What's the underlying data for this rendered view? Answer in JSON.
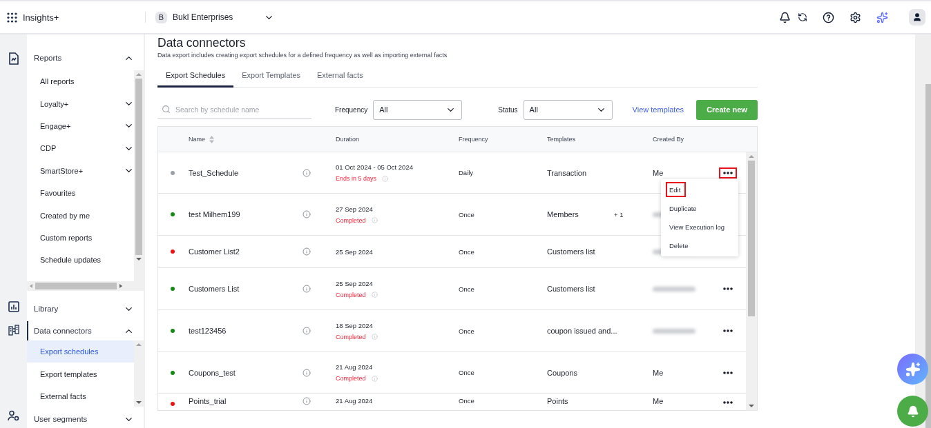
{
  "app": {
    "name": "Insights+"
  },
  "org": {
    "initial": "B",
    "name": "Bukl Enterprises"
  },
  "sidebar": {
    "sections": [
      {
        "label": "Reports",
        "expanded": true,
        "selected": false,
        "items": [
          {
            "label": "All reports",
            "has_children": false,
            "selected": false
          },
          {
            "label": "Loyalty+",
            "has_children": true,
            "expanded": false,
            "selected": false
          },
          {
            "label": "Engage+",
            "has_children": true,
            "expanded": false,
            "selected": false
          },
          {
            "label": "CDP",
            "has_children": true,
            "expanded": false,
            "selected": false
          },
          {
            "label": "SmartStore+",
            "has_children": true,
            "expanded": false,
            "selected": false
          },
          {
            "label": "Favourites",
            "has_children": false,
            "selected": false
          },
          {
            "label": "Created by me",
            "has_children": false,
            "selected": false
          },
          {
            "label": "Custom reports",
            "has_children": false,
            "selected": false
          },
          {
            "label": "Schedule updates",
            "has_children": false,
            "selected": false
          }
        ]
      },
      {
        "label": "Library",
        "expanded": false,
        "selected": false
      },
      {
        "label": "Data connectors",
        "expanded": true,
        "selected": true,
        "items": [
          {
            "label": "Export schedules",
            "has_children": false,
            "selected": true
          },
          {
            "label": "Export templates",
            "has_children": false,
            "selected": false
          },
          {
            "label": "External facts",
            "has_children": false,
            "selected": false
          }
        ]
      },
      {
        "label": "User segments",
        "expanded": false,
        "selected": false
      }
    ]
  },
  "page": {
    "title": "Data connectors",
    "subtitle": "Data export includes creating export schedules for a defined frequency as well as importing external facts"
  },
  "tabs": [
    {
      "label": "Export Schedules",
      "selected": true
    },
    {
      "label": "Export Templates",
      "selected": false
    },
    {
      "label": "External facts",
      "selected": false
    }
  ],
  "filters": {
    "search": {
      "placeholder": "Search by schedule name"
    },
    "frequency": {
      "label": "Frequency",
      "value": "All"
    },
    "status": {
      "label": "Status",
      "value": "All"
    },
    "link": "View templates",
    "create": "Create new"
  },
  "table": {
    "columns": [
      "Name",
      "Duration",
      "Frequency",
      "Templates",
      "Created By"
    ],
    "rows": [
      {
        "color": "#9aa0a8",
        "name": "Test_Schedule",
        "duration": "01 Oct 2024 - 05 Oct 2024",
        "status": "Ends in 5 days",
        "frequency": "Daily",
        "template": "Transaction",
        "extra": "",
        "created_by": "Me",
        "created_by_blurred": false,
        "menu_highlighted": true
      },
      {
        "color": "#138a13",
        "name": "test Milhem199",
        "duration": "27 Sep 2024",
        "status": "Completed",
        "frequency": "Once",
        "template": "Members",
        "extra": "+ 1",
        "created_by": "",
        "created_by_blurred": true
      },
      {
        "color": "#ee1111",
        "name": "Customer List2",
        "duration": "25 Sep 2024",
        "status": "",
        "frequency": "Once",
        "template": "Customers list",
        "extra": "",
        "created_by": "",
        "created_by_blurred": true
      },
      {
        "color": "#138a13",
        "name": "Customers List",
        "duration": "25 Sep 2024",
        "status": "Completed",
        "frequency": "Once",
        "template": "Customers list",
        "extra": "",
        "created_by": "",
        "created_by_blurred": true,
        "menu_highlighted": false
      },
      {
        "color": "#138a13",
        "name": "test123456",
        "duration": "18 Sep 2024",
        "status": "Completed",
        "frequency": "Once",
        "template": "coupon issued and...",
        "extra": "",
        "created_by": "",
        "created_by_blurred": true,
        "menu_highlighted": false
      },
      {
        "color": "#138a13",
        "name": "Coupons_test",
        "duration": "21 Aug 2024",
        "status": "Completed",
        "frequency": "Once",
        "template": "Coupons",
        "extra": "",
        "created_by": "Me",
        "created_by_blurred": false,
        "menu_highlighted": false
      },
      {
        "color": "#ee1111",
        "name": "Points_trial",
        "duration": "21 Aug 2024",
        "status": "",
        "frequency": "Once",
        "template": "Points",
        "extra": "",
        "created_by": "Me",
        "created_by_blurred": false,
        "menu_highlighted": false
      }
    ]
  },
  "row_menu": {
    "items": [
      {
        "label": "Edit",
        "highlighted": true
      },
      {
        "label": "Duplicate",
        "highlighted": false
      },
      {
        "label": "View Execution log",
        "highlighted": false
      },
      {
        "label": "Delete",
        "highlighted": false
      }
    ]
  }
}
